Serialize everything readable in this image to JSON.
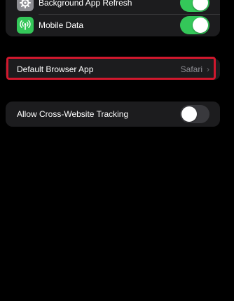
{
  "settings": {
    "background_refresh": {
      "label": "Background App Refresh",
      "icon": "gear-icon",
      "enabled": true
    },
    "mobile_data": {
      "label": "Mobile Data",
      "icon": "antenna-icon",
      "enabled": true
    },
    "default_browser": {
      "label": "Default Browser App",
      "value": "Safari",
      "chevron": "›"
    },
    "cross_site_tracking": {
      "label": "Allow Cross-Website Tracking",
      "enabled": false
    }
  },
  "colors": {
    "background": "#000000",
    "cell": "#1c1c1e",
    "toggle_on": "#34c759",
    "toggle_off": "#39393d",
    "highlight": "#d0182d",
    "secondary_text": "#8d8d93"
  }
}
